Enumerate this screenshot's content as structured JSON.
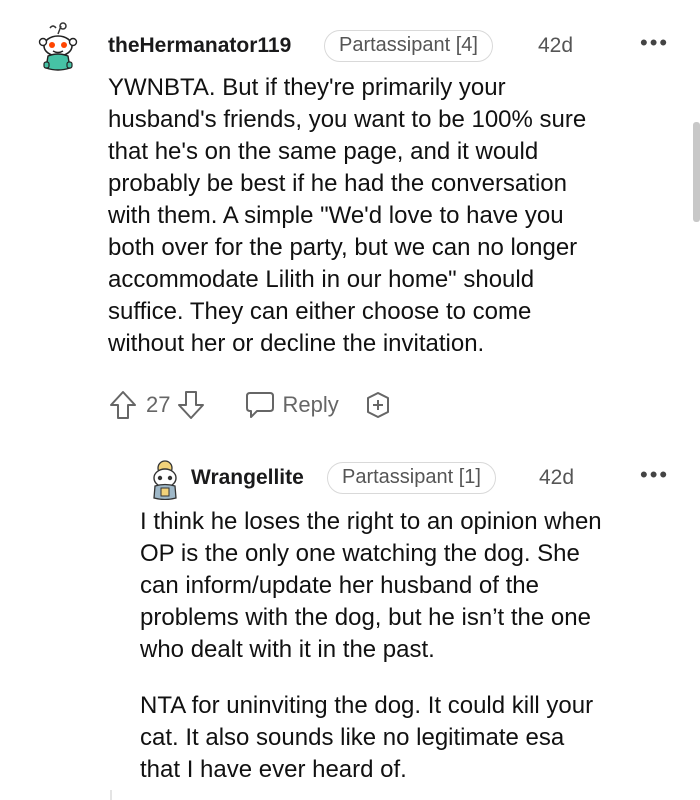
{
  "comments": [
    {
      "username": "theHermanator119",
      "flair": "Partassipant [4]",
      "age": "42d",
      "more": "•••",
      "body": [
        "YWNBTA. But if they're primarily your",
        "husband's friends, you want to be 100% sure",
        "that he's on the same page, and it would",
        "probably be best if he had the conversation",
        "with them. A simple \"We'd love to have you",
        "both over for the party, but we can no longer",
        "accommodate Lilith in our home\" should",
        "suffice. They can either choose to come",
        "without her or decline the invitation."
      ],
      "score": "27",
      "reply_label": "Reply"
    },
    {
      "username": "Wrangellite",
      "flair": "Partassipant [1]",
      "age": "42d",
      "more": "•••",
      "body_p1": [
        "I think he loses the right to an opinion when",
        "OP is the only one watching the dog. She",
        "can inform/update her husband of the",
        "problems with the dog, but he isn’t the one",
        "who dealt with it in the past."
      ],
      "body_p2": [
        "NTA for uninviting the dog. It could kill your",
        "cat. It also sounds like no legitimate esa",
        "that I have ever heard of."
      ]
    }
  ],
  "colors": {
    "text": "#111111",
    "meta": "#555555",
    "border": "#d9d9d9",
    "snoo_orange": "#ff4500"
  },
  "icons": {
    "upvote": "upvote-arrow-icon",
    "downvote": "downvote-arrow-icon",
    "reply": "speech-bubble-icon",
    "award": "award-plus-icon"
  }
}
